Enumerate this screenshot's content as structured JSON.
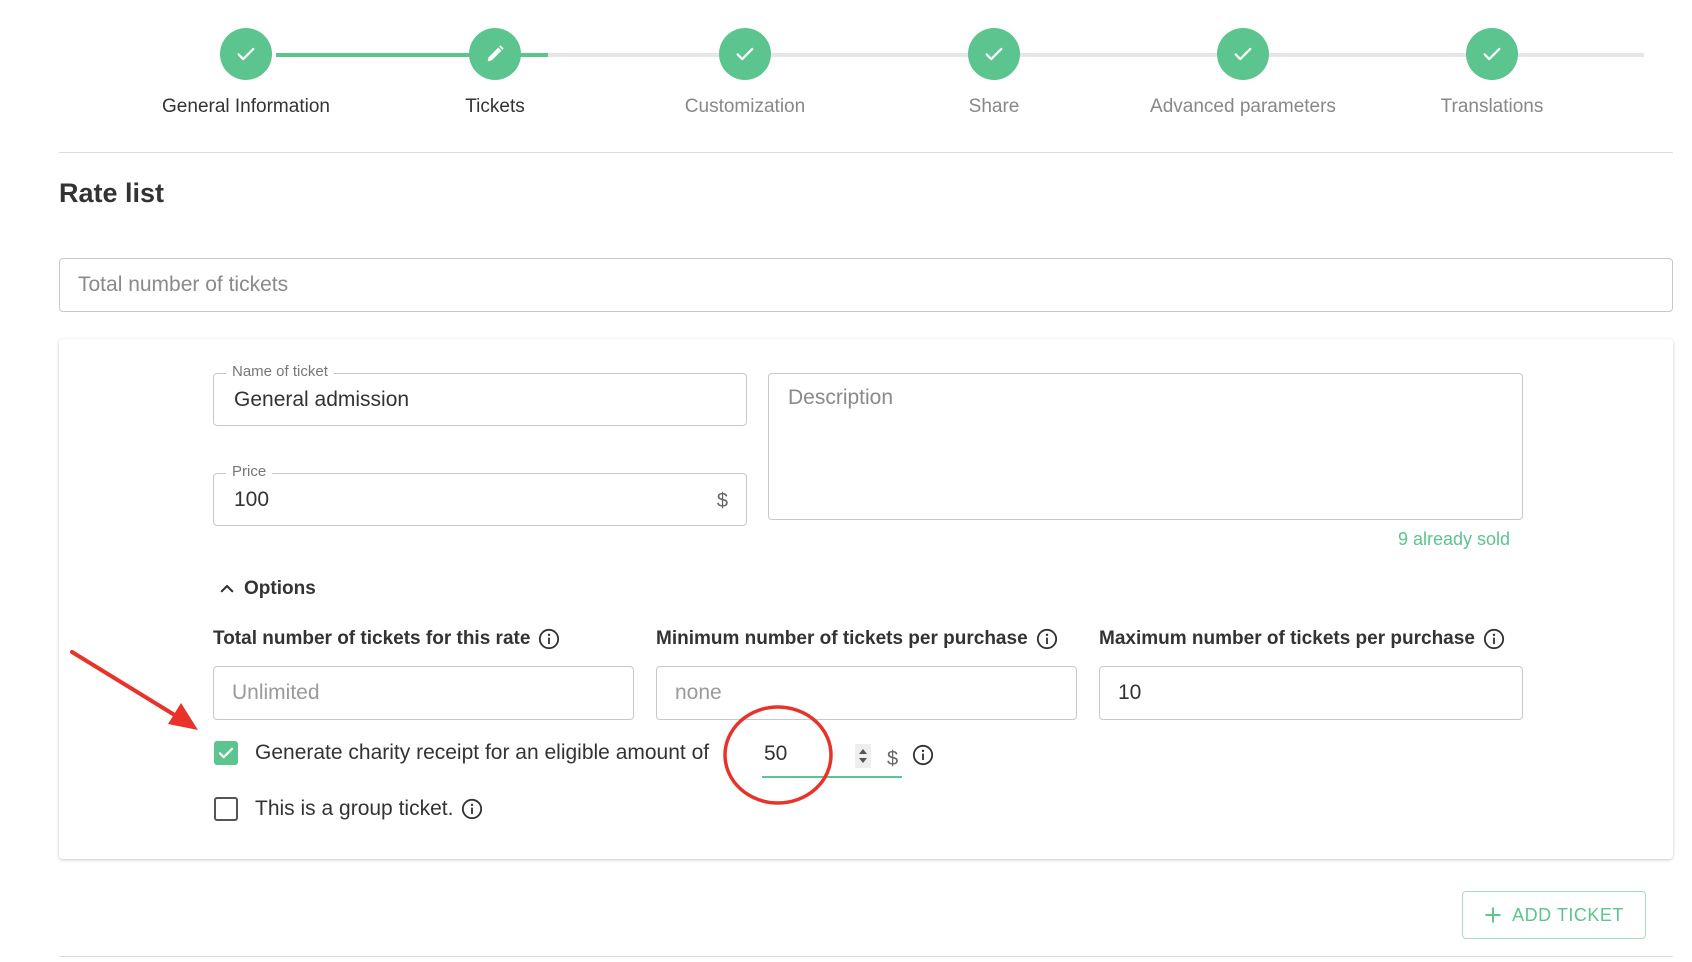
{
  "stepper": {
    "steps": [
      {
        "label": "General Information",
        "state": "done"
      },
      {
        "label": "Tickets",
        "state": "current"
      },
      {
        "label": "Customization",
        "state": "done"
      },
      {
        "label": "Share",
        "state": "done"
      },
      {
        "label": "Advanced parameters",
        "state": "done"
      },
      {
        "label": "Translations",
        "state": "done"
      }
    ]
  },
  "page": {
    "title": "Rate list",
    "total_tickets_placeholder": "Total number of tickets"
  },
  "ticket": {
    "name_label": "Name of ticket",
    "name_value": "General admission",
    "price_label": "Price",
    "price_value": "100",
    "currency": "$",
    "description_placeholder": "Description",
    "sold_text": "9 already sold",
    "options_label": "Options",
    "total_rate_label": "Total number of tickets for this rate",
    "total_rate_placeholder": "Unlimited",
    "min_label": "Minimum number of tickets per purchase",
    "min_placeholder": "none",
    "max_label": "Maximum number of tickets per purchase",
    "max_value": "10",
    "charity_label": "Generate charity receipt for an eligible amount of",
    "charity_checked": true,
    "charity_amount": "50",
    "group_label": "This is a group ticket.",
    "group_checked": false
  },
  "actions": {
    "add_ticket_label": "ADD TICKET"
  },
  "colors": {
    "accent": "#5cc48e",
    "annotation": "#e8332a"
  }
}
